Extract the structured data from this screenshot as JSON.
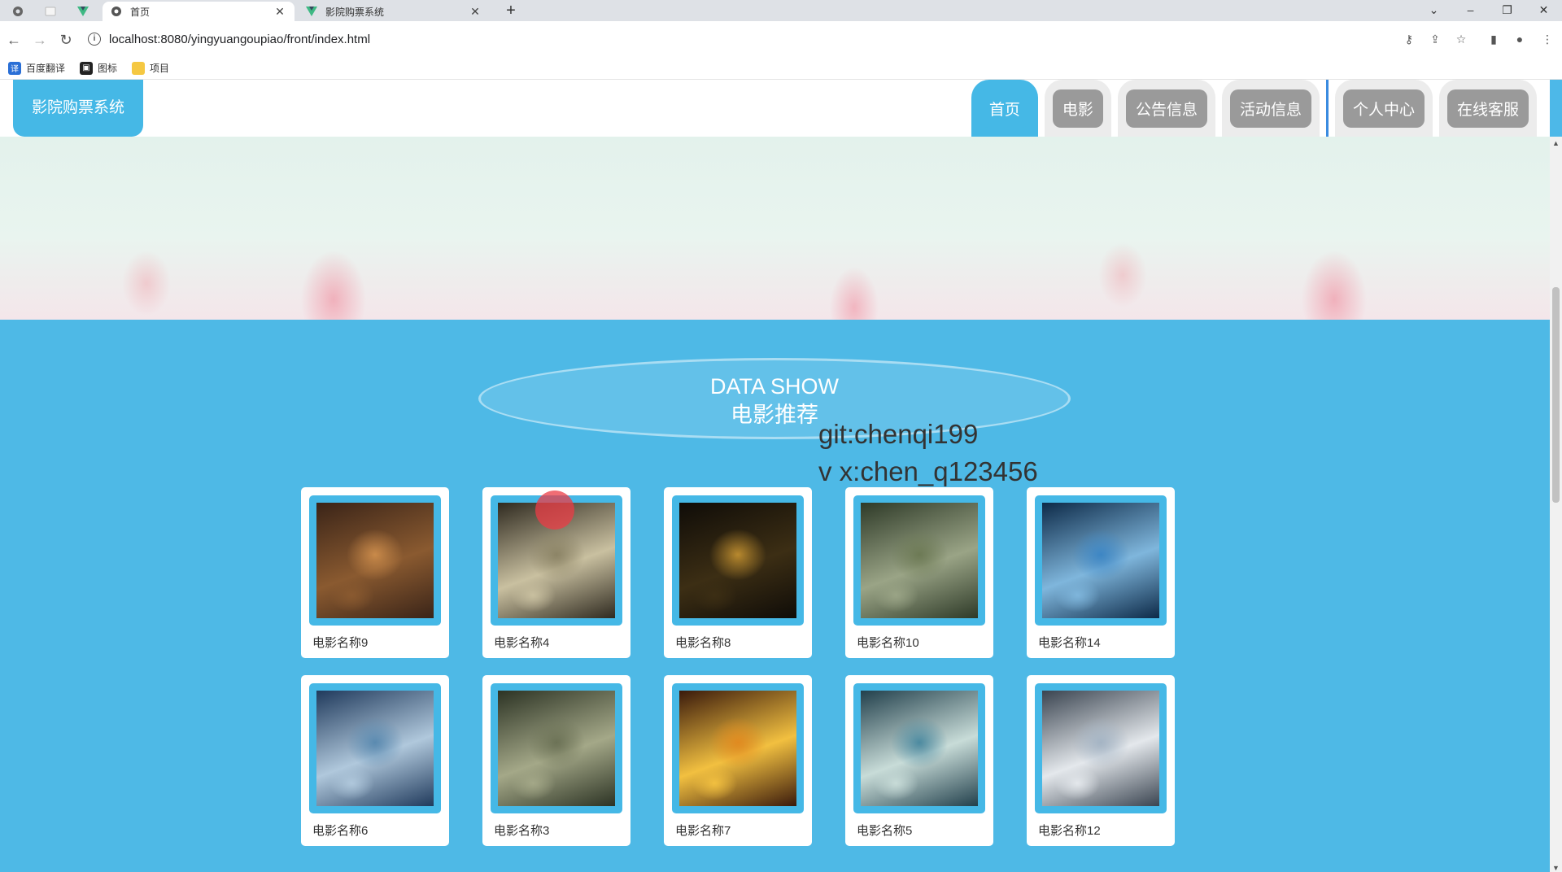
{
  "browser": {
    "tabs": [
      {
        "title": "首页",
        "active": true
      },
      {
        "title": "影院购票系统",
        "active": false
      }
    ],
    "new_tab": "+",
    "url": "localhost:8080/yingyuangoupiao/front/index.html",
    "bookmarks": [
      {
        "label": "百度翻译",
        "icon": "translate-icon"
      },
      {
        "label": "图标",
        "icon": "image-icon"
      },
      {
        "label": "项目",
        "icon": "folder-icon"
      }
    ]
  },
  "site": {
    "logo": "影院购票系统",
    "nav": [
      "首页",
      "电影",
      "公告信息",
      "活动信息",
      "个人中心",
      "在线客服"
    ],
    "active_nav": "首页"
  },
  "carousel": {
    "slide_count": 3,
    "active_index": 0
  },
  "section": {
    "title_en": "DATA SHOW",
    "title_cn": "电影推荐"
  },
  "watermark": {
    "line1": "git:chenqi199",
    "line2": "v x:chen_q123456"
  },
  "movies": [
    {
      "name": "电影名称9",
      "icon": "film-clapper-poster"
    },
    {
      "name": "电影名称4",
      "icon": "war-movie-poster"
    },
    {
      "name": "电影名称8",
      "icon": "clapperboard-poster"
    },
    {
      "name": "电影名称10",
      "icon": "forest-movie-poster"
    },
    {
      "name": "电影名称14",
      "icon": "avatar-poster"
    },
    {
      "name": "电影名称6",
      "icon": "mermaid-poster"
    },
    {
      "name": "电影名称3",
      "icon": "drama-poster"
    },
    {
      "name": "电影名称7",
      "icon": "western-poster"
    },
    {
      "name": "电影名称5",
      "icon": "call-of-wild-poster"
    },
    {
      "name": "电影名称12",
      "icon": "space-movie-poster"
    }
  ],
  "colors": {
    "primary": "#45b8e6",
    "section_bg": "#4eb9e6",
    "nav_pill": "#9a9a9a"
  }
}
